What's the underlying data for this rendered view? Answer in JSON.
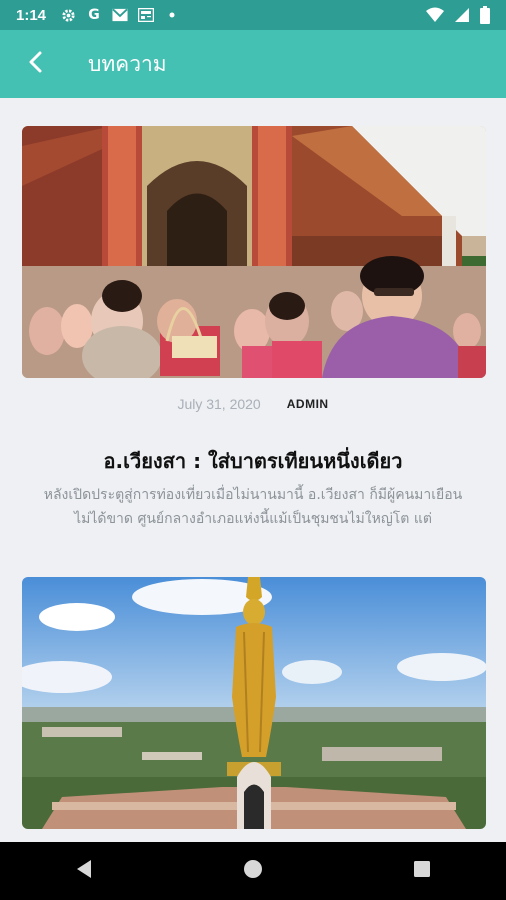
{
  "status_bar": {
    "time": "1:14",
    "icons": [
      "gear-icon",
      "google-icon",
      "gmail-icon",
      "news-icon",
      "dot-icon"
    ],
    "right_icons": [
      "wifi-icon",
      "signal-icon",
      "battery-icon"
    ]
  },
  "app_bar": {
    "title": "บทความ",
    "back_icon": "back-arrow-icon",
    "color": "#45c1b4"
  },
  "articles": [
    {
      "date": "July 31, 2020",
      "author": "ADMIN",
      "title": "อ.เวียงสา : ใส่บาตรเทียนหนึ่งเดียว",
      "excerpt": "หลังเปิดประตูสู่การท่องเที่ยวเมื่อไม่นานมานี้ อ.เวียงสา ก็มีผู้คนมาเยือนไม่ได้ขาด ศูนย์กลางอำเภอแห่งนี้แม้เป็นชุมชนไม่ใหญ่โต แต่"
    },
    {
      "image": "golden-buddha-statue-image"
    }
  ],
  "nav_bar": {
    "buttons": [
      "back-triangle-icon",
      "home-circle-icon",
      "recents-square-icon"
    ]
  }
}
